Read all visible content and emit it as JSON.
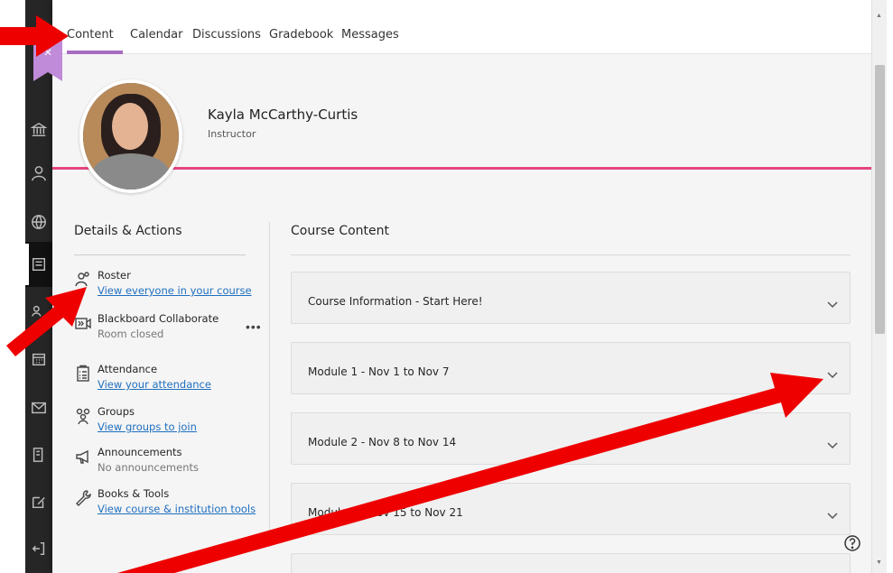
{
  "tabs": [
    {
      "label": "Content",
      "active": true
    },
    {
      "label": "Calendar"
    },
    {
      "label": "Discussions"
    },
    {
      "label": "Gradebook"
    },
    {
      "label": "Messages"
    }
  ],
  "close_icon": "×",
  "profile": {
    "name": "Kayla McCarthy-Curtis",
    "role": "Instructor"
  },
  "details": {
    "title": "Details & Actions",
    "items": [
      {
        "icon": "roster-icon",
        "label": "Roster",
        "sub": "View everyone in your course",
        "sub_type": "link"
      },
      {
        "icon": "collaborate-icon",
        "label": "Blackboard Collaborate",
        "sub": "Room closed",
        "sub_type": "muted",
        "more": "•••"
      },
      {
        "icon": "attendance-icon",
        "label": "Attendance",
        "sub": "View your attendance",
        "sub_type": "link"
      },
      {
        "icon": "groups-icon",
        "label": "Groups",
        "sub": "View groups to join",
        "sub_type": "link"
      },
      {
        "icon": "announcements-icon",
        "label": "Announcements",
        "sub": "No announcements",
        "sub_type": "muted"
      },
      {
        "icon": "tools-icon",
        "label": "Books & Tools",
        "sub": "View course & institution tools",
        "sub_type": "link"
      }
    ]
  },
  "content": {
    "title": "Course Content",
    "modules": [
      {
        "title": "Course Information - Start Here!"
      },
      {
        "title": "Module 1 - Nov 1 to Nov 7"
      },
      {
        "title": "Module 2 - Nov 8 to Nov 14"
      },
      {
        "title": "Module 3 - Nov 15 to Nov 21"
      }
    ]
  },
  "colors": {
    "accent_purple": "#a66cc0",
    "header_pink": "#e5467f",
    "link_blue": "#1f6fbf",
    "annotation_red": "#ee0000"
  }
}
